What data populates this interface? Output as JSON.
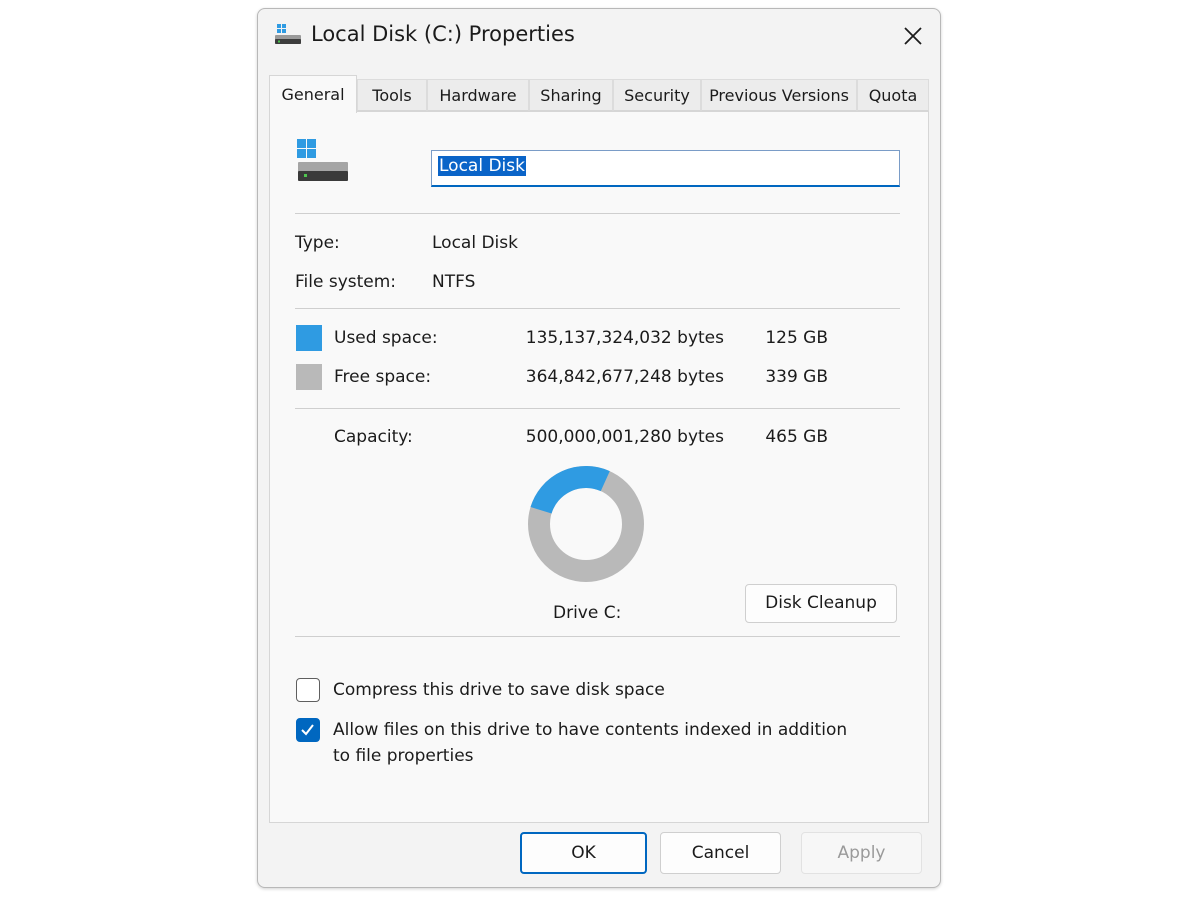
{
  "window": {
    "title": "Local Disk (C:) Properties",
    "title_icon": "drive-icon",
    "close_icon": "close-icon"
  },
  "tabs": [
    {
      "label": "General",
      "active": true
    },
    {
      "label": "Tools"
    },
    {
      "label": "Hardware"
    },
    {
      "label": "Sharing"
    },
    {
      "label": "Security"
    },
    {
      "label": "Previous Versions"
    },
    {
      "label": "Quota"
    }
  ],
  "general": {
    "drive_icon": "windows-drive-icon",
    "name_value": "Local Disk",
    "type_label": "Type:",
    "type_value": "Local Disk",
    "fs_label": "File system:",
    "fs_value": "NTFS",
    "used": {
      "label": "Used space:",
      "bytes": "135,137,324,032 bytes",
      "size": "125 GB",
      "color": "#2f9be2"
    },
    "free": {
      "label": "Free space:",
      "bytes": "364,842,677,248 bytes",
      "size": "339 GB",
      "color": "#b9b9b9"
    },
    "capacity": {
      "label": "Capacity:",
      "bytes": "500,000,001,280 bytes",
      "size": "465 GB"
    },
    "used_fraction": 0.27,
    "drive_label": "Drive C:",
    "cleanup_button": "Disk Cleanup",
    "compress": {
      "label": "Compress this drive to save disk space",
      "checked": false
    },
    "index": {
      "label_line1": "Allow files on this drive to have contents indexed in addition",
      "label_line2": "to file properties",
      "checked": true
    }
  },
  "footer": {
    "ok": "OK",
    "cancel": "Cancel",
    "apply": "Apply"
  },
  "colors": {
    "accent": "#0067c0",
    "used": "#2f9be2",
    "free": "#b9b9b9"
  }
}
